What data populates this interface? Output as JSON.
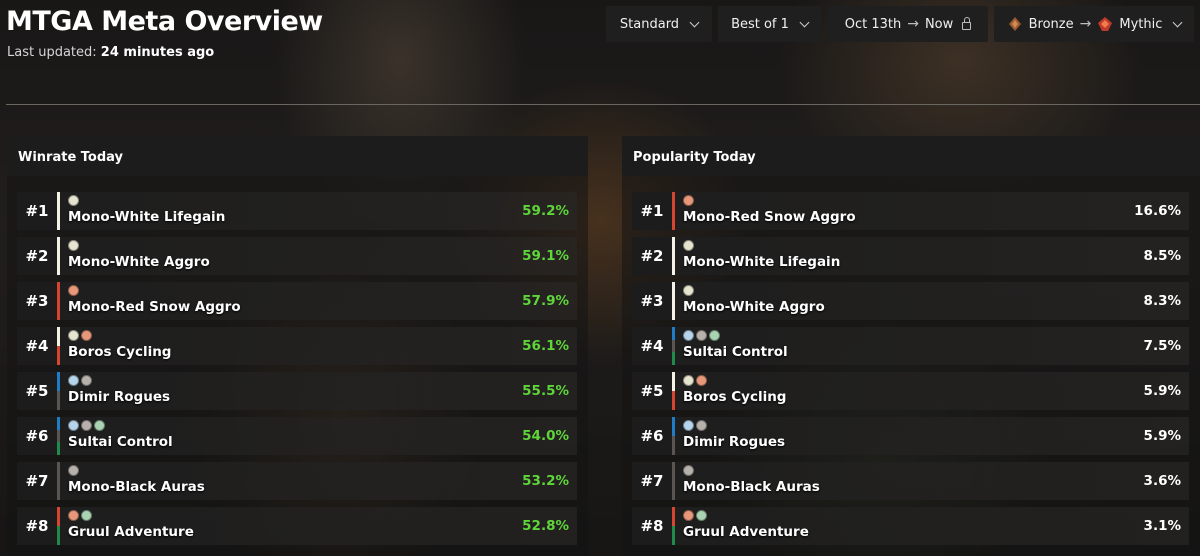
{
  "header": {
    "title": "MTGA Meta Overview",
    "updated_label": "Last updated:",
    "updated_value": "24 minutes ago"
  },
  "filters": {
    "format": "Standard",
    "match_type": "Best of 1",
    "date_from": "Oct 13th",
    "date_to": "Now",
    "rank_from": "Bronze",
    "rank_to": "Mythic"
  },
  "colors": {
    "W": "#e6e3cf",
    "U": "#b6d4ec",
    "B": "#b7b1ac",
    "R": "#e8987a",
    "G": "#a9d3b2",
    "bar_W": "#f4f2e6",
    "bar_U": "#1f7cc6",
    "bar_B": "#5a5552",
    "bar_R": "#d6452f",
    "bar_G": "#1f8a4a",
    "winrate_green": "#5ed63a",
    "popularity_white": "#ffffff"
  },
  "winrate": {
    "title": "Winrate Today",
    "rows": [
      {
        "rank": "#1",
        "name": "Mono-White Lifegain",
        "value": "59.2%",
        "colors": [
          "W"
        ]
      },
      {
        "rank": "#2",
        "name": "Mono-White Aggro",
        "value": "59.1%",
        "colors": [
          "W"
        ]
      },
      {
        "rank": "#3",
        "name": "Mono-Red Snow Aggro",
        "value": "57.9%",
        "colors": [
          "R"
        ]
      },
      {
        "rank": "#4",
        "name": "Boros Cycling",
        "value": "56.1%",
        "colors": [
          "W",
          "R"
        ]
      },
      {
        "rank": "#5",
        "name": "Dimir Rogues",
        "value": "55.5%",
        "colors": [
          "U",
          "B"
        ]
      },
      {
        "rank": "#6",
        "name": "Sultai Control",
        "value": "54.0%",
        "colors": [
          "U",
          "B",
          "G"
        ]
      },
      {
        "rank": "#7",
        "name": "Mono-Black Auras",
        "value": "53.2%",
        "colors": [
          "B"
        ]
      },
      {
        "rank": "#8",
        "name": "Gruul Adventure",
        "value": "52.8%",
        "colors": [
          "R",
          "G"
        ]
      }
    ]
  },
  "popularity": {
    "title": "Popularity Today",
    "rows": [
      {
        "rank": "#1",
        "name": "Mono-Red Snow Aggro",
        "value": "16.6%",
        "colors": [
          "R"
        ]
      },
      {
        "rank": "#2",
        "name": "Mono-White Lifegain",
        "value": "8.5%",
        "colors": [
          "W"
        ]
      },
      {
        "rank": "#3",
        "name": "Mono-White Aggro",
        "value": "8.3%",
        "colors": [
          "W"
        ]
      },
      {
        "rank": "#4",
        "name": "Sultai Control",
        "value": "7.5%",
        "colors": [
          "U",
          "B",
          "G"
        ]
      },
      {
        "rank": "#5",
        "name": "Boros Cycling",
        "value": "5.9%",
        "colors": [
          "W",
          "R"
        ]
      },
      {
        "rank": "#6",
        "name": "Dimir Rogues",
        "value": "5.9%",
        "colors": [
          "U",
          "B"
        ]
      },
      {
        "rank": "#7",
        "name": "Mono-Black Auras",
        "value": "3.6%",
        "colors": [
          "B"
        ]
      },
      {
        "rank": "#8",
        "name": "Gruul Adventure",
        "value": "3.1%",
        "colors": [
          "R",
          "G"
        ]
      }
    ]
  }
}
